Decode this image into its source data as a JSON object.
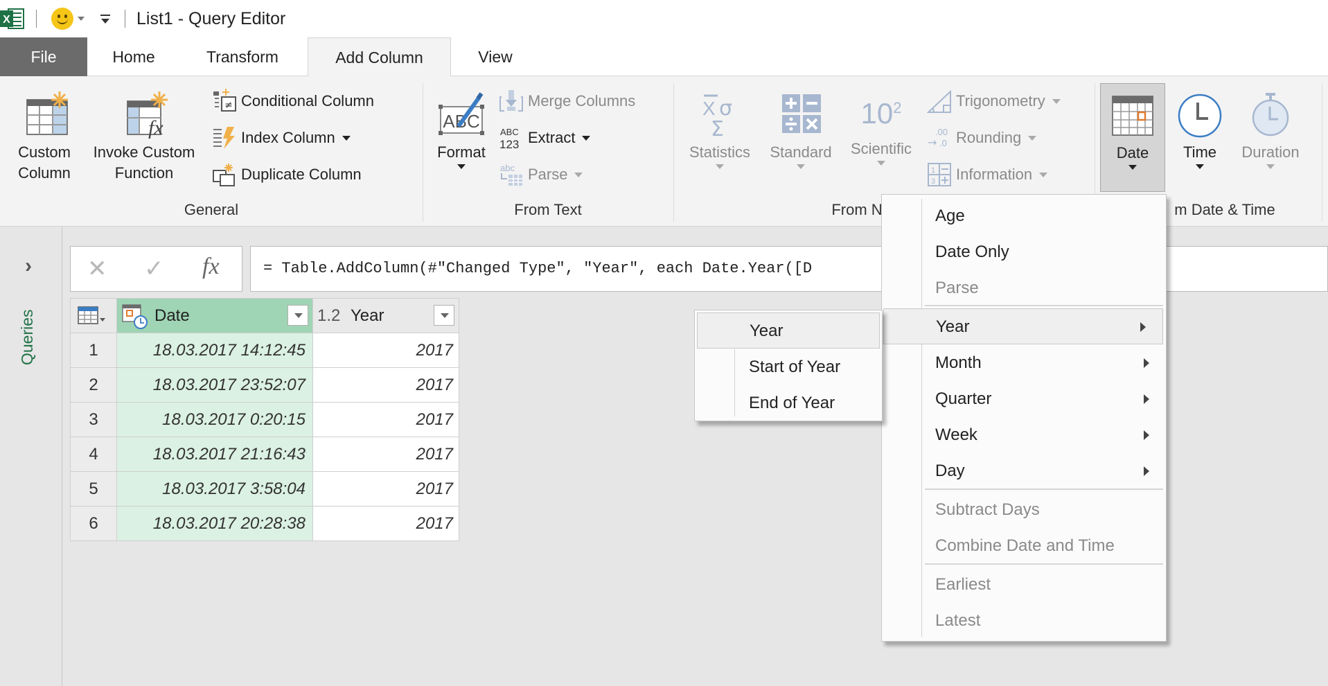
{
  "window": {
    "title": "List1 - Query Editor",
    "app_icon": "excel-icon",
    "qat_icons": [
      "smiley-feedback-icon",
      "customize-qat-icon"
    ]
  },
  "tabs": [
    {
      "label": "File",
      "active": false
    },
    {
      "label": "Home",
      "active": false
    },
    {
      "label": "Transform",
      "active": false
    },
    {
      "label": "Add Column",
      "active": true
    },
    {
      "label": "View",
      "active": false
    }
  ],
  "ribbon": {
    "general": {
      "label": "General",
      "custom_column": {
        "label1": "Custom",
        "label2": "Column",
        "icon": "custom-column-icon"
      },
      "invoke_custom_function": {
        "label1": "Invoke Custom",
        "label2": "Function",
        "icon": "invoke-function-icon"
      },
      "conditional_column": {
        "label": "Conditional Column",
        "icon": "conditional-column-icon"
      },
      "index_column": {
        "label": "Index Column",
        "icon": "index-column-icon"
      },
      "duplicate_column": {
        "label": "Duplicate Column",
        "icon": "duplicate-column-icon"
      }
    },
    "from_text": {
      "label": "From Text",
      "format": {
        "label": "Format",
        "icon": "format-abc-icon"
      },
      "merge_columns": {
        "label": "Merge Columns",
        "icon": "merge-columns-icon",
        "disabled": true
      },
      "extract": {
        "label": "Extract",
        "icon": "extract-abc123-icon"
      },
      "parse": {
        "label": "Parse",
        "icon": "parse-icon",
        "disabled": true
      }
    },
    "from_number": {
      "label": "From N",
      "statistics": {
        "label": "Statistics",
        "icon": "statistics-sigma-icon",
        "disabled": true
      },
      "standard": {
        "label": "Standard",
        "icon": "standard-operators-icon",
        "disabled": true
      },
      "scientific": {
        "label": "Scientific",
        "icon": "scientific-power-icon",
        "disabled": true,
        "glyph": "10",
        "sup": "2"
      },
      "trigonometry": {
        "label": "Trigonometry",
        "icon": "trigonometry-icon",
        "disabled": true
      },
      "rounding": {
        "label": "Rounding",
        "icon": "rounding-icon",
        "disabled": true
      },
      "information": {
        "label": "Information",
        "icon": "information-icon",
        "disabled": true
      }
    },
    "from_date_time": {
      "label": "m Date & Time",
      "date": {
        "label": "Date",
        "icon": "calendar-icon",
        "pressed": true
      },
      "time": {
        "label": "Time",
        "icon": "clock-icon"
      },
      "duration": {
        "label": "Duration",
        "icon": "stopwatch-icon",
        "disabled": true
      }
    }
  },
  "queries_pane": {
    "label": "Queries",
    "expand_icon": "chevron-right-icon"
  },
  "formula_bar": {
    "cancel_glyph": "✕",
    "commit_glyph": "✓",
    "fx_glyph": "fx",
    "formula": "= Table.AddColumn(#\"Changed Type\", \"Year\", each Date.Year([D"
  },
  "table": {
    "columns": [
      {
        "name": "Date",
        "type_icon": "datetime-type-icon",
        "selected": true
      },
      {
        "name": "Year",
        "type_label": "1.2",
        "selected": false
      }
    ],
    "rows": [
      {
        "index": "1",
        "date": "18.03.2017 14:12:45",
        "year": "2017"
      },
      {
        "index": "2",
        "date": "18.03.2017 23:52:07",
        "year": "2017"
      },
      {
        "index": "3",
        "date": "18.03.2017 0:20:15",
        "year": "2017"
      },
      {
        "index": "4",
        "date": "18.03.2017 21:16:43",
        "year": "2017"
      },
      {
        "index": "5",
        "date": "18.03.2017 3:58:04",
        "year": "2017"
      },
      {
        "index": "6",
        "date": "18.03.2017 20:28:38",
        "year": "2017"
      }
    ]
  },
  "date_menu": {
    "items": [
      {
        "label": "Age",
        "disabled": false,
        "submenu": false
      },
      {
        "label": "Date Only",
        "disabled": false,
        "submenu": false
      },
      {
        "label": "Parse",
        "disabled": true,
        "submenu": false
      },
      {
        "label": "Year",
        "disabled": false,
        "submenu": true,
        "highlighted": true
      },
      {
        "label": "Month",
        "disabled": false,
        "submenu": true
      },
      {
        "label": "Quarter",
        "disabled": false,
        "submenu": true
      },
      {
        "label": "Week",
        "disabled": false,
        "submenu": true
      },
      {
        "label": "Day",
        "disabled": false,
        "submenu": true
      },
      {
        "label": "Subtract Days",
        "disabled": true,
        "submenu": false
      },
      {
        "label": "Combine Date and Time",
        "disabled": true,
        "submenu": false
      },
      {
        "label": "Earliest",
        "disabled": true,
        "submenu": false
      },
      {
        "label": "Latest",
        "disabled": true,
        "submenu": false
      }
    ]
  },
  "year_submenu": {
    "items": [
      {
        "label": "Year",
        "highlighted": true
      },
      {
        "label": "Start of Year"
      },
      {
        "label": "End of Year"
      }
    ]
  },
  "colors": {
    "excel_green": "#217346",
    "selected_column_header": "#9fd4b4",
    "selected_column_cells": "#dbf1e3",
    "file_tab": "#6b6b6b",
    "disabled_icon_blue": "#a7b7cf",
    "calendar_accent": "#e07b2f"
  }
}
